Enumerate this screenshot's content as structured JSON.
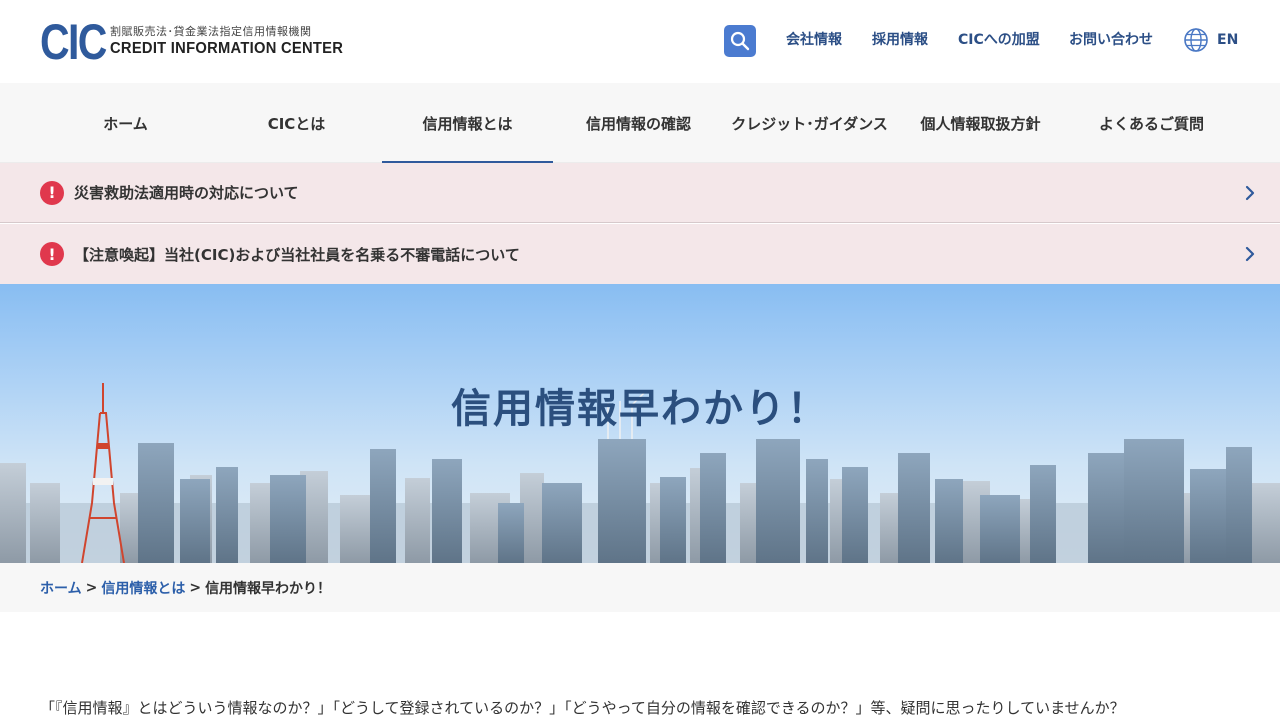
{
  "header": {
    "logo_mark": "CIC",
    "logo_ja": "割賦販売法･貸金業法指定信用情報機関",
    "logo_en": "CREDIT INFORMATION CENTER",
    "search_icon": "search-icon",
    "util_links": [
      "会社情報",
      "採用情報",
      "CICへの加盟",
      "お問い合わせ"
    ],
    "lang_icon": "globe-icon",
    "lang_label": "EN"
  },
  "nav": {
    "items": [
      "ホーム",
      "CICとは",
      "信用情報とは",
      "信用情報の確認",
      "クレジット･ガイダンス",
      "個人情報取扱方針",
      "よくあるご質問"
    ],
    "active_index": 2
  },
  "alerts": [
    {
      "icon": "exclamation-icon",
      "text": "災害救助法適用時の対応について"
    },
    {
      "icon": "exclamation-icon",
      "text": "【注意喚起】当社(CIC)および当社社員を名乗る不審電話について"
    }
  ],
  "hero": {
    "title": "信用情報早わかり！"
  },
  "breadcrumb": {
    "home": "ホーム",
    "sep1": ">",
    "parent": "信用情報とは",
    "sep2": ">",
    "current": "信用情報早わかり！"
  },
  "intro": {
    "text": "「『信用情報』とはどういう情報なのか？」「どうして登録されているのか？」「どうやって自分の情報を確認できるのか？」等、疑問に思ったりしていませんか？"
  },
  "colors": {
    "brand": "#2f5a9c",
    "link": "#2c4f86",
    "alert_bg": "#f4e7e9",
    "alert_icon": "#e0384d",
    "search_bg": "#4b7bd0"
  }
}
